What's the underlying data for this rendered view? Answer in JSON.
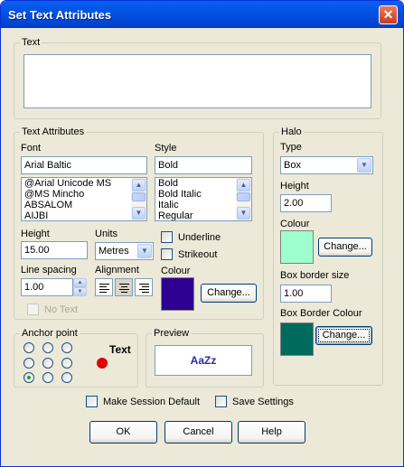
{
  "window": {
    "title": "Set Text Attributes",
    "close_glyph": "✕"
  },
  "text_group": {
    "legend": "Text",
    "value": ""
  },
  "text_attributes": {
    "legend": "Text Attributes",
    "font_label": "Font",
    "font_value": "Arial Baltic",
    "font_list": [
      "@Arial Unicode MS",
      "@MS Mincho",
      "ABSALOM",
      "AIJBI"
    ],
    "style_label": "Style",
    "style_value": "Bold",
    "style_list": [
      "Bold",
      "Bold Italic",
      "Italic",
      "Regular"
    ],
    "height_label": "Height",
    "height_value": "15.00",
    "units_label": "Units",
    "units_value": "Metres",
    "underline_label": "Underline",
    "strikeout_label": "Strikeout",
    "line_spacing_label": "Line spacing",
    "line_spacing_value": "1.00",
    "alignment_label": "Alignment",
    "alignment_selected": "center",
    "colour_label": "Colour",
    "colour_value": "#2E0091",
    "change_label": "Change...",
    "no_text_label": "No Text"
  },
  "halo": {
    "legend": "Halo",
    "type_label": "Type",
    "type_value": "Box",
    "height_label": "Height",
    "height_value": "2.00",
    "colour_label": "Colour",
    "colour_value": "#9EFFCF",
    "change_label": "Change...",
    "box_border_size_label": "Box border size",
    "box_border_size_value": "1.00",
    "box_border_colour_label": "Box Border Colour",
    "box_border_colour_value": "#006A5E",
    "box_change_label": "Change..."
  },
  "anchor_point": {
    "legend": "Anchor point",
    "sample_text": "Text",
    "selected": "bottom-left",
    "marker_colour": "#E00000"
  },
  "preview": {
    "legend": "Preview",
    "sample": "AaZz"
  },
  "options": {
    "make_session_default_label": "Make Session Default",
    "save_settings_label": "Save Settings"
  },
  "buttons": {
    "ok_label": "OK",
    "cancel_label": "Cancel",
    "help_label": "Help"
  },
  "colors": {
    "title_bar": "#0054E3",
    "dialog_bg": "#ECE9D8",
    "input_border": "#7F9DB9"
  },
  "icons": {
    "close": "close-icon",
    "dropdown": "chevron-down-icon",
    "scroll_up": "chevron-up-icon",
    "scroll_down": "chevron-down-icon",
    "spinner": "spinner-icon",
    "align_left": "align-left-icon",
    "align_center": "align-center-icon",
    "align_right": "align-right-icon"
  }
}
